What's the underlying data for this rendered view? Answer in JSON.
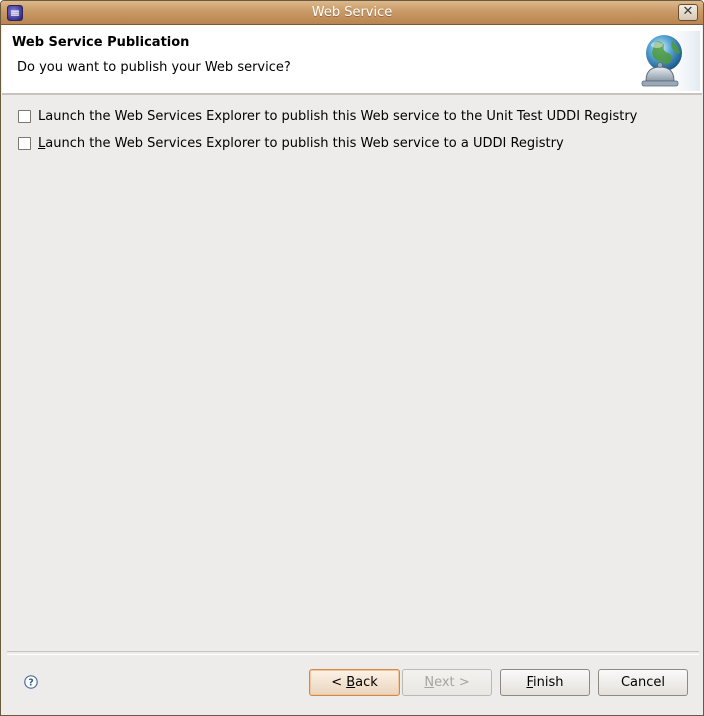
{
  "window": {
    "title": "Web Service"
  },
  "banner": {
    "title": "Web Service Publication",
    "description": "Do you want to publish your Web service?",
    "icon": "globe-bell-icon"
  },
  "options": [
    {
      "mnemonic": "",
      "rest": "Launch the Web Services Explorer to publish this Web service to the Unit Test UDDI Registry",
      "checked": false
    },
    {
      "mnemonic": "L",
      "rest": "aunch the Web Services Explorer to publish this Web service to a UDDI Registry",
      "checked": false
    }
  ],
  "buttons": {
    "back": {
      "prefix": "< ",
      "mnemonic": "B",
      "rest": "ack"
    },
    "next": {
      "mnemonic": "N",
      "rest": "ext >",
      "enabled": false
    },
    "finish": {
      "mnemonic": "F",
      "rest": "inish"
    },
    "cancel": {
      "label": "Cancel"
    }
  },
  "help": {
    "icon": "help-icon",
    "glyph": "?"
  }
}
